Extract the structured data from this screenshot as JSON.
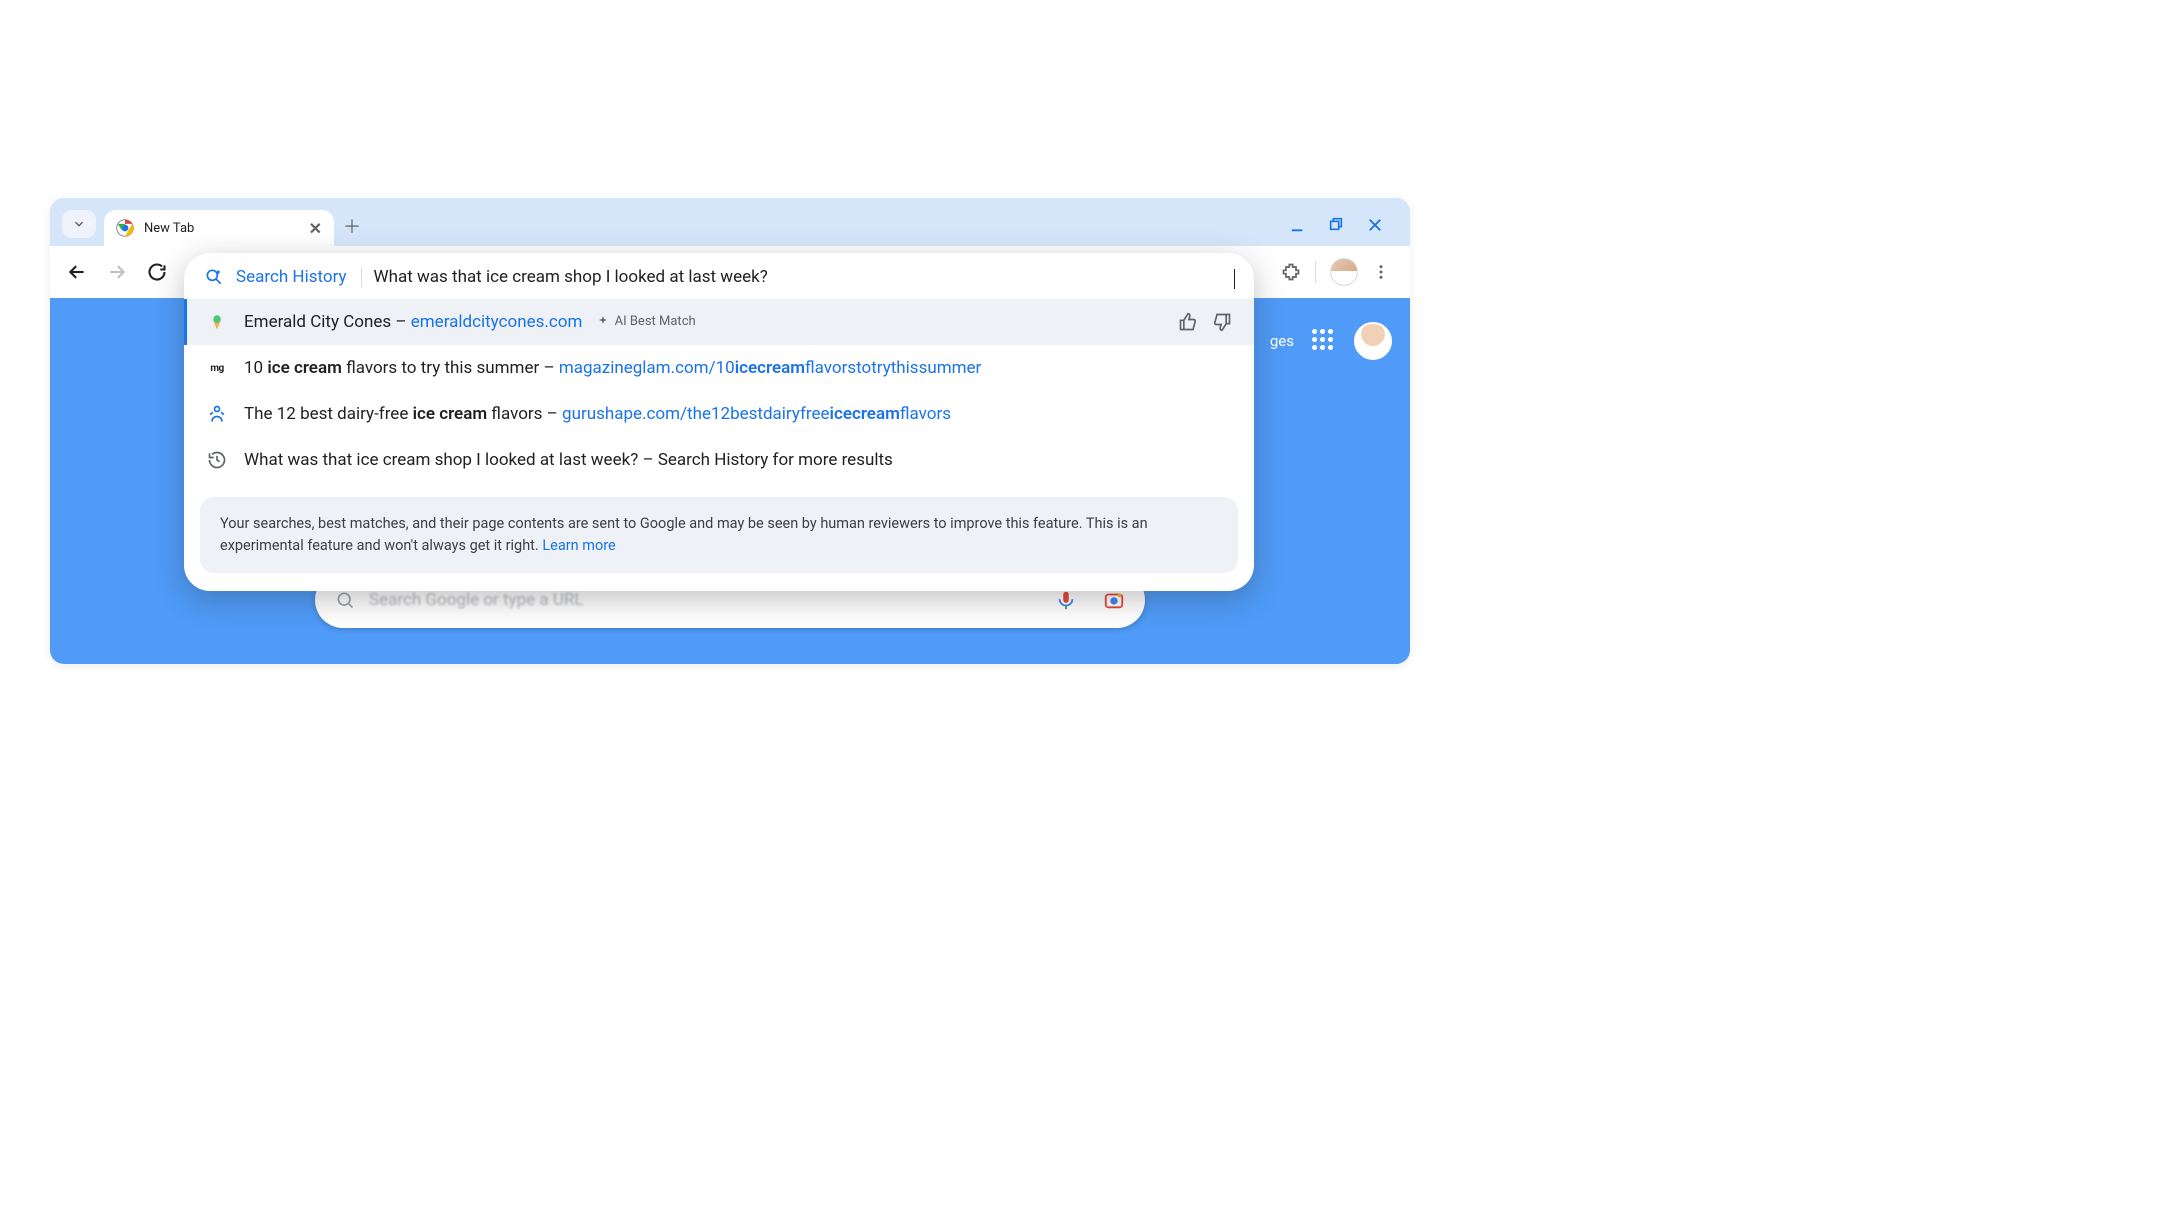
{
  "tab": {
    "title": "New Tab"
  },
  "omnibox": {
    "scope_label": "Search History",
    "query": "What was that ice cream shop I looked at last week?"
  },
  "suggestions": [
    {
      "title_prefix": "Emerald City Cones – ",
      "url_display": "emeraldcitycones.com",
      "badge": "AI Best Match",
      "selected": true,
      "feedback": true,
      "icon": "cone"
    },
    {
      "plain_before": "10 ",
      "bold": "ice cream",
      "plain_after": " flavors to try this summer – ",
      "url_before": "magazineglam.com/10",
      "url_bold": "icecream",
      "url_after": "flavorstotrythissummer",
      "icon": "mg"
    },
    {
      "plain_before": "The 12 best dairy-free ",
      "bold": "ice cream",
      "plain_after": " flavors – ",
      "url_before": "gurushape.com/the12bestdairyfree",
      "url_bold": "icecream",
      "url_after": "flavors",
      "icon": "guru"
    },
    {
      "full_text": "What was that ice cream shop I looked at last week? – Search History for more results",
      "icon": "history"
    }
  ],
  "notice": {
    "text": "Your searches, best matches, and their page contents are sent to Google and may be seen by human reviewers to improve this feature. This is an experimental feature and won't always get it right. ",
    "link": "Learn more"
  },
  "search_pill": {
    "placeholder": "Search Google or type a URL"
  },
  "top_links": {
    "fragment": "ges"
  }
}
